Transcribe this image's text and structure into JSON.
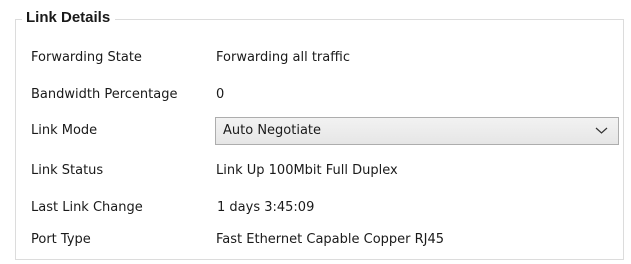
{
  "group": {
    "title": "Link Details"
  },
  "fields": {
    "forwarding_state": {
      "label": "Forwarding State",
      "value": "Forwarding all traffic"
    },
    "bandwidth_percentage": {
      "label": "Bandwidth Percentage",
      "value": "0"
    },
    "link_mode": {
      "label": "Link Mode",
      "selected": "Auto Negotiate",
      "icon": "chevron-down-icon"
    },
    "link_status": {
      "label": "Link Status",
      "value": "Link Up 100Mbit Full Duplex"
    },
    "last_link_change": {
      "label": "Last Link Change",
      "value": "1 days 3:45:09"
    },
    "port_type": {
      "label": "Port Type",
      "value": "Fast Ethernet Capable Copper RJ45"
    }
  },
  "colors": {
    "border": "#dcdcdc",
    "select_border": "#adadad",
    "select_bg": "#e6e6e6",
    "text": "#1a1a1a"
  }
}
